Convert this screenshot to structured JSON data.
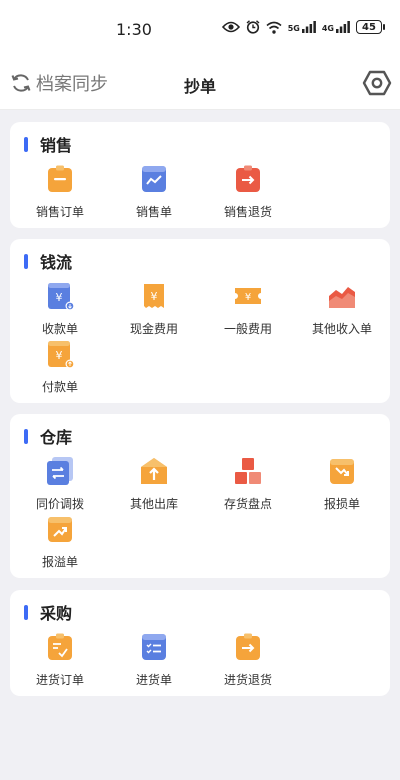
{
  "status_bar": {
    "time": "1:30",
    "battery": "45",
    "icons": [
      "eye-icon",
      "alarm-icon",
      "wifi-icon",
      "signal-5g-icon",
      "signal-4g-icon",
      "battery-icon"
    ],
    "signal1_label": "5G",
    "signal2_label": "4G"
  },
  "header": {
    "sync_label": "档案同步",
    "title": "抄单",
    "settings_icon": "gear-icon"
  },
  "colors": {
    "accent": "#3d6bf5",
    "orange": "#f5a43b",
    "blue": "#5a7fe0",
    "red": "#ea5a44"
  },
  "sections": [
    {
      "title": "销售",
      "items": [
        {
          "label": "销售订单",
          "icon": "sales-order-icon"
        },
        {
          "label": "销售单",
          "icon": "sales-bill-icon"
        },
        {
          "label": "销售退货",
          "icon": "sales-return-icon"
        }
      ]
    },
    {
      "title": "钱流",
      "items": [
        {
          "label": "收款单",
          "icon": "receipt-icon"
        },
        {
          "label": "现金费用",
          "icon": "cash-expense-icon"
        },
        {
          "label": "一般费用",
          "icon": "general-expense-icon"
        },
        {
          "label": "其他收入单",
          "icon": "other-income-icon"
        },
        {
          "label": "付款单",
          "icon": "payment-icon"
        }
      ]
    },
    {
      "title": "仓库",
      "items": [
        {
          "label": "同价调拨",
          "icon": "transfer-icon"
        },
        {
          "label": "其他出库",
          "icon": "other-outbound-icon"
        },
        {
          "label": "存货盘点",
          "icon": "stocktake-icon"
        },
        {
          "label": "报损单",
          "icon": "loss-report-icon"
        },
        {
          "label": "报溢单",
          "icon": "overflow-report-icon"
        }
      ]
    },
    {
      "title": "采购",
      "items": [
        {
          "label": "进货订单",
          "icon": "purchase-order-icon"
        },
        {
          "label": "进货单",
          "icon": "purchase-bill-icon"
        },
        {
          "label": "进货退货",
          "icon": "purchase-return-icon"
        }
      ]
    }
  ]
}
